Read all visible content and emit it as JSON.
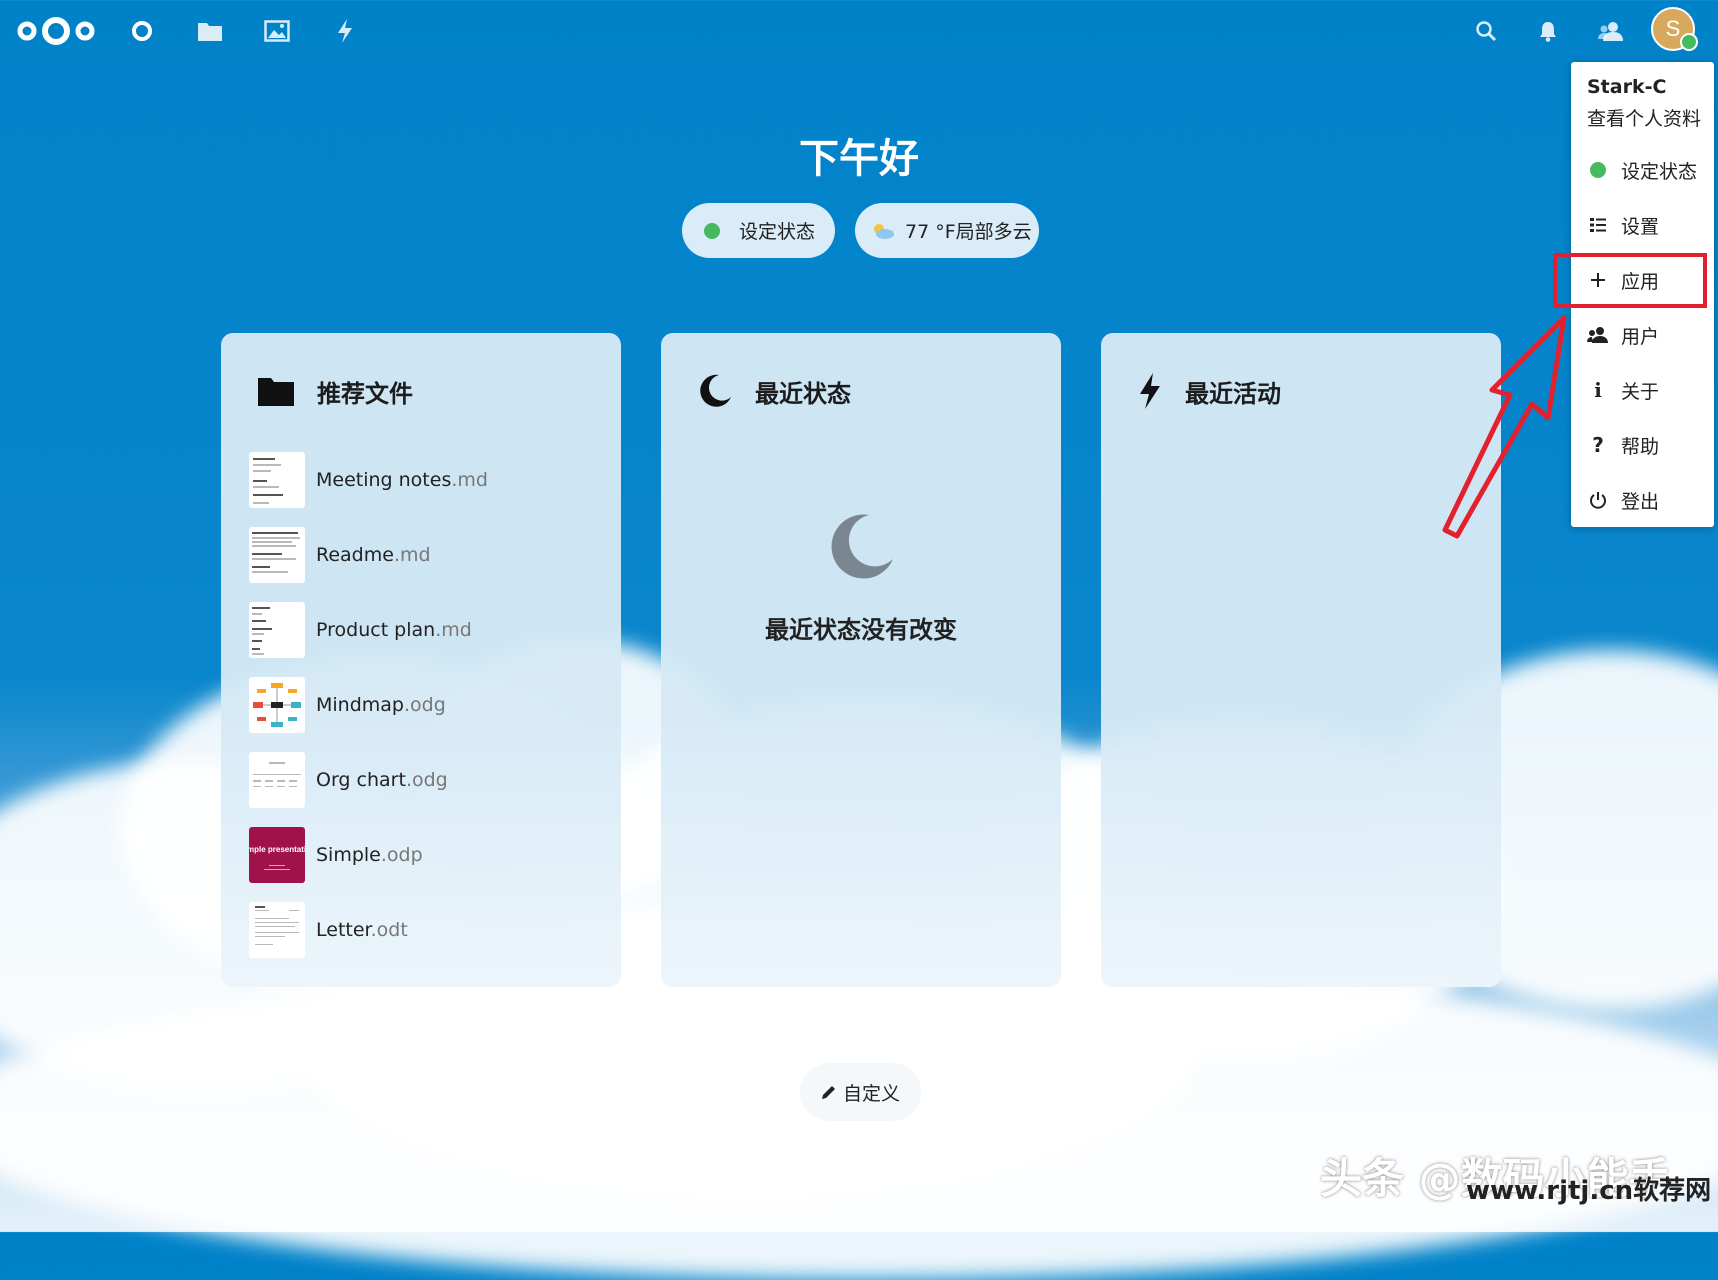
{
  "topbar": {
    "app_icons": [
      "nextcloud-logo",
      "dashboard-icon",
      "files-icon",
      "photos-icon",
      "activity-icon"
    ],
    "right_icons": [
      "search-icon",
      "notifications-icon",
      "contacts-icon"
    ],
    "avatar_initial": "S"
  },
  "greeting": "下午好",
  "status_pill": "设定状态",
  "weather_pill": "77 °F局部多云",
  "panels": [
    {
      "title": "推荐文件",
      "icon": "folder-icon",
      "files": [
        {
          "name": "Meeting notes",
          "ext": ".md"
        },
        {
          "name": "Readme",
          "ext": ".md"
        },
        {
          "name": "Product plan",
          "ext": ".md"
        },
        {
          "name": "Mindmap",
          "ext": ".odg"
        },
        {
          "name": "Org chart",
          "ext": ".odg"
        },
        {
          "name": "Simple",
          "ext": ".odp",
          "thumb_text": "mple presentati"
        },
        {
          "name": "Letter",
          "ext": ".odt"
        }
      ]
    },
    {
      "title": "最近状态",
      "icon": "moon-icon",
      "empty_message": "最近状态没有改变"
    },
    {
      "title": "最近活动",
      "icon": "lightning-icon"
    }
  ],
  "customize_label": "自定义",
  "user_menu": {
    "username": "Stark-C",
    "profile_link": "查看个人资料",
    "items": [
      {
        "label": "设定状态",
        "icon": "status-dot-icon"
      },
      {
        "label": "设置",
        "icon": "settings-list-icon"
      },
      {
        "label": "应用",
        "icon": "plus-icon"
      },
      {
        "label": "用户",
        "icon": "users-icon"
      },
      {
        "label": "关于",
        "icon": "info-icon"
      },
      {
        "label": "帮助",
        "icon": "help-icon"
      },
      {
        "label": "登出",
        "icon": "power-icon"
      }
    ]
  },
  "annotation_color": "#e3202e",
  "accent": "#0082c9",
  "watermark": "头条 @数码小能手",
  "watermark2": "www.rjtj.cn软荐网"
}
